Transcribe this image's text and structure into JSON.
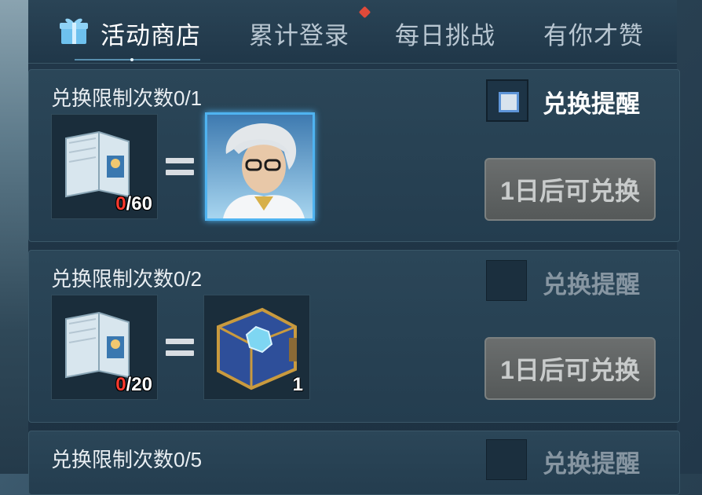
{
  "tabs": [
    {
      "label": "活动商店",
      "active": true
    },
    {
      "label": "累计登录",
      "active": false,
      "has_dot": true
    },
    {
      "label": "每日挑战",
      "active": false
    },
    {
      "label": "有你才赞",
      "active": false
    }
  ],
  "cards": [
    {
      "title": "兑换限制次数0/1",
      "cost_current": "0",
      "cost_total": "/60",
      "reward": "hero-portrait",
      "reward_qty": "",
      "reminder_on": true,
      "reminder_label": "兑换提醒",
      "button_label": "1日后可兑换"
    },
    {
      "title": "兑换限制次数0/2",
      "cost_current": "0",
      "cost_total": "/20",
      "reward": "blue-book",
      "reward_qty": "1",
      "reminder_on": false,
      "reminder_label": "兑换提醒",
      "button_label": "1日后可兑换"
    },
    {
      "title": "兑换限制次数0/5",
      "reminder_on": false,
      "reminder_label": "兑换提醒"
    }
  ],
  "colors": {
    "accent": "#4fb3f0",
    "alert_red": "#ff3a2e",
    "tab_active": "#ffffff",
    "tab_inactive": "#b8c6d1"
  }
}
